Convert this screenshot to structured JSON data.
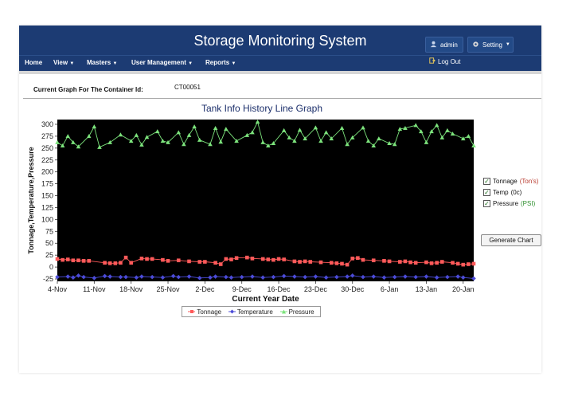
{
  "app": {
    "title": "Storage Monitoring System"
  },
  "header": {
    "admin_label": "admin",
    "setting_label": "Setting",
    "logout_label": "Log Out"
  },
  "nav": {
    "items": [
      {
        "label": "Home",
        "dropdown": false
      },
      {
        "label": "View",
        "dropdown": true
      },
      {
        "label": "Masters",
        "dropdown": true
      },
      {
        "label": "User Management",
        "dropdown": true
      },
      {
        "label": "Reports",
        "dropdown": true
      }
    ]
  },
  "container": {
    "label": "Current Graph For The Container Id:",
    "id": "CT00051"
  },
  "side_panel": {
    "checkboxes": [
      {
        "label": "Tonnage",
        "unit": "(Ton's)",
        "checked": true
      },
      {
        "label": "Temp",
        "unit": "(0c)",
        "checked": true
      },
      {
        "label": "Pressure",
        "unit": "(PSI)",
        "checked": true
      }
    ],
    "generate_label": "Generate Chart"
  },
  "colors": {
    "header": "#1c3b73",
    "tonnage": "#ff5a5a",
    "temperature": "#4b4bd8",
    "pressure": "#7ce37c",
    "plot_bg": "#000000"
  },
  "chart_data": {
    "type": "line",
    "title": "Tank Info History Line Graph",
    "xlabel": "Current Year Date",
    "ylabel": "Tonnage,Temperature,Pressure",
    "ylim": [
      -30,
      310
    ],
    "yticks": [
      -25,
      0,
      25,
      50,
      75,
      100,
      125,
      150,
      175,
      200,
      225,
      250,
      275,
      300
    ],
    "xticks": [
      "4-Nov",
      "11-Nov",
      "18-Nov",
      "25-Nov",
      "2-Dec",
      "9-Dec",
      "16-Dec",
      "23-Dec",
      "30-Dec",
      "6-Jan",
      "13-Jan",
      "20-Jan"
    ],
    "legend_position": "bottom",
    "series": [
      {
        "name": "Tonnage",
        "color": "#ff5a5a",
        "marker": "square",
        "values": [
          [
            0,
            17
          ],
          [
            1,
            15
          ],
          [
            2,
            16
          ],
          [
            3,
            14
          ],
          [
            4,
            14
          ],
          [
            5,
            13
          ],
          [
            6,
            13
          ],
          [
            9,
            9
          ],
          [
            10,
            8
          ],
          [
            11,
            8
          ],
          [
            12,
            9
          ],
          [
            13,
            20
          ],
          [
            14,
            9
          ],
          [
            16,
            18
          ],
          [
            17,
            17
          ],
          [
            18,
            17
          ],
          [
            20,
            15
          ],
          [
            21,
            13
          ],
          [
            23,
            14
          ],
          [
            25,
            12
          ],
          [
            27,
            11
          ],
          [
            28,
            11
          ],
          [
            30,
            9
          ],
          [
            31,
            6
          ],
          [
            32,
            17
          ],
          [
            33,
            16
          ],
          [
            34,
            19
          ],
          [
            36,
            20
          ],
          [
            37,
            18
          ],
          [
            39,
            17
          ],
          [
            40,
            16
          ],
          [
            41,
            15
          ],
          [
            42,
            17
          ],
          [
            43,
            16
          ],
          [
            45,
            12
          ],
          [
            46,
            11
          ],
          [
            47,
            12
          ],
          [
            48,
            11
          ],
          [
            50,
            10
          ],
          [
            52,
            9
          ],
          [
            53,
            8
          ],
          [
            54,
            7
          ],
          [
            55,
            5
          ],
          [
            56,
            18
          ],
          [
            57,
            19
          ],
          [
            58,
            15
          ],
          [
            60,
            14
          ],
          [
            62,
            13
          ],
          [
            63,
            12
          ],
          [
            65,
            11
          ],
          [
            66,
            12
          ],
          [
            67,
            10
          ],
          [
            68,
            9
          ],
          [
            70,
            10
          ],
          [
            71,
            8
          ],
          [
            72,
            9
          ],
          [
            73,
            11
          ],
          [
            75,
            9
          ],
          [
            76,
            7
          ],
          [
            77,
            5
          ],
          [
            78,
            6
          ],
          [
            79,
            7
          ]
        ]
      },
      {
        "name": "Temperature",
        "color": "#4b4bd8",
        "marker": "diamond",
        "values": [
          [
            0,
            -21
          ],
          [
            2,
            -20
          ],
          [
            3,
            -22
          ],
          [
            4,
            -18
          ],
          [
            5,
            -21
          ],
          [
            7,
            -23
          ],
          [
            9,
            -19
          ],
          [
            10,
            -20
          ],
          [
            12,
            -21
          ],
          [
            13,
            -21
          ],
          [
            15,
            -22
          ],
          [
            16,
            -20
          ],
          [
            18,
            -21
          ],
          [
            20,
            -22
          ],
          [
            22,
            -19
          ],
          [
            23,
            -21
          ],
          [
            25,
            -20
          ],
          [
            27,
            -23
          ],
          [
            29,
            -22
          ],
          [
            30,
            -20
          ],
          [
            32,
            -21
          ],
          [
            33,
            -22
          ],
          [
            35,
            -21
          ],
          [
            37,
            -20
          ],
          [
            39,
            -22
          ],
          [
            41,
            -21
          ],
          [
            43,
            -19
          ],
          [
            45,
            -20
          ],
          [
            47,
            -21
          ],
          [
            49,
            -20
          ],
          [
            51,
            -22
          ],
          [
            53,
            -21
          ],
          [
            55,
            -20
          ],
          [
            56,
            -18
          ],
          [
            58,
            -21
          ],
          [
            60,
            -20
          ],
          [
            62,
            -22
          ],
          [
            64,
            -21
          ],
          [
            66,
            -20
          ],
          [
            68,
            -21
          ],
          [
            70,
            -20
          ],
          [
            72,
            -22
          ],
          [
            74,
            -21
          ],
          [
            76,
            -20
          ],
          [
            77,
            -22
          ],
          [
            79,
            -24
          ]
        ]
      },
      {
        "name": "Pressure",
        "color": "#7ce37c",
        "marker": "triangle",
        "values": [
          [
            0,
            262
          ],
          [
            1,
            255
          ],
          [
            2,
            275
          ],
          [
            3,
            262
          ],
          [
            4,
            253
          ],
          [
            6,
            275
          ],
          [
            7,
            295
          ],
          [
            8,
            252
          ],
          [
            10,
            262
          ],
          [
            12,
            278
          ],
          [
            14,
            265
          ],
          [
            15,
            277
          ],
          [
            16,
            257
          ],
          [
            17,
            273
          ],
          [
            19,
            285
          ],
          [
            20,
            265
          ],
          [
            21,
            262
          ],
          [
            23,
            283
          ],
          [
            24,
            258
          ],
          [
            25,
            277
          ],
          [
            26,
            295
          ],
          [
            27,
            267
          ],
          [
            29,
            258
          ],
          [
            30,
            292
          ],
          [
            31,
            263
          ],
          [
            32,
            290
          ],
          [
            34,
            265
          ],
          [
            36,
            277
          ],
          [
            37,
            283
          ],
          [
            38,
            305
          ],
          [
            39,
            262
          ],
          [
            40,
            255
          ],
          [
            41,
            260
          ],
          [
            43,
            287
          ],
          [
            44,
            272
          ],
          [
            45,
            265
          ],
          [
            46,
            288
          ],
          [
            47,
            270
          ],
          [
            49,
            293
          ],
          [
            50,
            265
          ],
          [
            51,
            283
          ],
          [
            52,
            270
          ],
          [
            54,
            292
          ],
          [
            55,
            258
          ],
          [
            56,
            272
          ],
          [
            58,
            293
          ],
          [
            59,
            265
          ],
          [
            60,
            255
          ],
          [
            61,
            270
          ],
          [
            63,
            260
          ],
          [
            64,
            258
          ],
          [
            65,
            290
          ],
          [
            66,
            292
          ],
          [
            68,
            298
          ],
          [
            69,
            285
          ],
          [
            70,
            262
          ],
          [
            71,
            285
          ],
          [
            72,
            298
          ],
          [
            73,
            272
          ],
          [
            74,
            287
          ],
          [
            75,
            280
          ],
          [
            77,
            270
          ],
          [
            78,
            275
          ],
          [
            79,
            255
          ]
        ]
      }
    ]
  }
}
